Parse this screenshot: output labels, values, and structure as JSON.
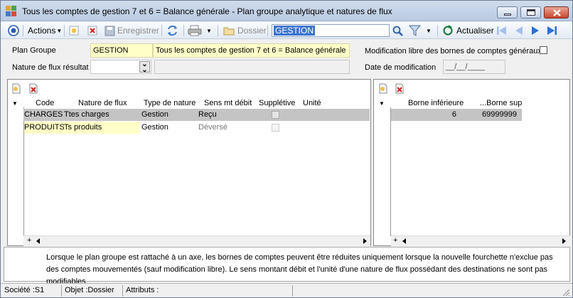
{
  "window": {
    "title": "Tous  les  comptes de gestion 7 et 6  = Balance générale -  Plan groupe analytique et natures de flux"
  },
  "toolbar": {
    "actions_label": "Actions",
    "save_label": "Enregistrer",
    "dossier_label": "Dossier",
    "search_value": "GESTION",
    "refresh_label": "Actualiser"
  },
  "form": {
    "plan_groupe_label": "Plan Groupe",
    "plan_groupe_code": "GESTION",
    "plan_groupe_desc": "Tous  les  comptes de gestion 7 et 6  = Balance générale",
    "nature_flux_label": "Nature de flux résultat",
    "nature_flux_value": "",
    "modif_libre_label": "Modification libre des bornes de comptes généraux",
    "modif_libre_checked": false,
    "date_modif_label": "Date de modification",
    "date_modif_value": "__/__/____"
  },
  "left_grid": {
    "headers": [
      "Code",
      "Nature de flux",
      "Type de nature",
      "Sens mt débit",
      "Supplétive",
      "Unité"
    ],
    "rows": [
      {
        "code": "CHARGES",
        "nature": "Ttes charges",
        "type": "Gestion",
        "sens": "Reçu",
        "suppletive": false,
        "unite": ""
      },
      {
        "code": "PRODUITS",
        "nature": "Ts produits",
        "type": "Gestion",
        "sens": "Déversé",
        "suppletive": false,
        "unite": ""
      }
    ]
  },
  "right_grid": {
    "headers": [
      "Borne inférieure",
      "...Borne sup"
    ],
    "rows": [
      {
        "borne_inf": "6",
        "borne_sup": "69999999"
      }
    ]
  },
  "info": {
    "text": "Lorsque le plan groupe est rattaché à un axe, les bornes de comptes peuvent être réduites uniquement lorsque la nouvelle fourchette n'exclue pas des comptes mouvementés (sauf modification libre). Le sens montant débit et l'unité d'une nature de flux possédant des destinations ne sont pas modifiables."
  },
  "status": {
    "societe": "Société :S1",
    "objet": "Objet :Dossier",
    "attributs": "Attributs :"
  },
  "colors": {
    "yellow_field": "#ffffc8",
    "selection": "#3b74d1",
    "nav_arrow": "#2a6fd6"
  }
}
